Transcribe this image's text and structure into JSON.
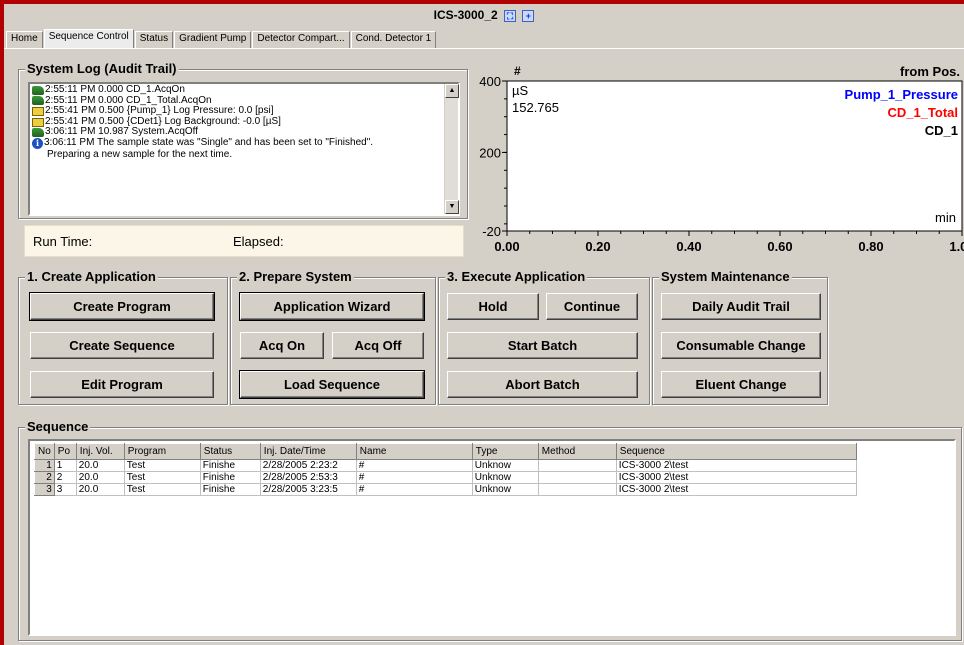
{
  "window": {
    "title": "ICS-3000_2",
    "title_icons": [
      "maximize-icon",
      "split-icon"
    ]
  },
  "tabs": [
    {
      "label": "Home",
      "active": false
    },
    {
      "label": "Sequence Control",
      "active": true
    },
    {
      "label": "Status",
      "active": false
    },
    {
      "label": "Gradient Pump",
      "active": false
    },
    {
      "label": "Detector Compart...",
      "active": false
    },
    {
      "label": "Cond. Detector 1",
      "active": false
    }
  ],
  "system_log": {
    "title": "System Log (Audit Trail)",
    "entries": [
      {
        "icon": "run-icon",
        "text": "2:55:11 PM 0.000 CD_1.AcqOn"
      },
      {
        "icon": "run-icon",
        "text": "2:55:11 PM 0.000 CD_1_Total.AcqOn"
      },
      {
        "icon": "book-icon",
        "text": "2:55:41 PM 0.500 {Pump_1} Log Pressure: 0.0 [psi]"
      },
      {
        "icon": "book-icon",
        "text": "2:55:41 PM 0.500 {CDet1} Log Background: -0.0 [µS]"
      },
      {
        "icon": "run-icon",
        "text": "3:06:11 PM 10.987 System.AcqOff"
      },
      {
        "icon": "info-icon",
        "text": "3:06:11 PM The sample state was \"Single\" and has been set to \"Finished\"."
      }
    ],
    "continuation": "Preparing a new sample for the next time."
  },
  "run_info": {
    "run_time_label": "Run Time:",
    "elapsed_label": "Elapsed:"
  },
  "chart_data": {
    "type": "line",
    "title": "#",
    "header_right": "from Pos.",
    "ylabel": "µS",
    "current_value": "152.765",
    "xlabel": "min",
    "ylim": [
      -20,
      400
    ],
    "xlim": [
      0.0,
      1.0
    ],
    "y_ticks": [
      "400",
      "200",
      "-20"
    ],
    "x_ticks": [
      "0.00",
      "0.20",
      "0.40",
      "0.60",
      "0.80",
      "1.00"
    ],
    "series": [
      {
        "name": "Pump_1_Pressure",
        "color": "#0000ff",
        "values": []
      },
      {
        "name": "CD_1_Total",
        "color": "#ff0000",
        "values": []
      },
      {
        "name": "CD_1",
        "color": "#000000",
        "values": []
      }
    ],
    "grid": false
  },
  "groups": {
    "create": {
      "title": "1. Create Application",
      "buttons": [
        "Create Program",
        "Create Sequence",
        "Edit Program"
      ]
    },
    "prepare": {
      "title": "2. Prepare System",
      "wizard": "Application Wizard",
      "acq_on": "Acq On",
      "acq_off": "Acq Off",
      "load": "Load Sequence"
    },
    "execute": {
      "title": "3. Execute Application",
      "hold": "Hold",
      "continue": "Continue",
      "start": "Start Batch",
      "abort": "Abort Batch"
    },
    "maintenance": {
      "title": "System Maintenance",
      "buttons": [
        "Daily Audit Trail",
        "Consumable Change",
        "Eluent Change"
      ]
    }
  },
  "sequence": {
    "title": "Sequence",
    "columns": [
      "No",
      "Po",
      "Inj. Vol.",
      "Program",
      "Status",
      "Inj. Date/Time",
      "Name",
      "Type",
      "Method",
      "Sequence"
    ],
    "rows": [
      [
        "1",
        "1",
        "20.0",
        "Test",
        "Finishe",
        "2/28/2005 2:23:2",
        "#",
        "Unknow",
        "",
        "ICS-3000  2\\test"
      ],
      [
        "2",
        "2",
        "20.0",
        "Test",
        "Finishe",
        "2/28/2005 2:53:3",
        "#",
        "Unknow",
        "",
        "ICS-3000  2\\test"
      ],
      [
        "3",
        "3",
        "20.0",
        "Test",
        "Finishe",
        "2/28/2005 3:23:5",
        "#",
        "Unknow",
        "",
        "ICS-3000  2\\test"
      ]
    ]
  }
}
